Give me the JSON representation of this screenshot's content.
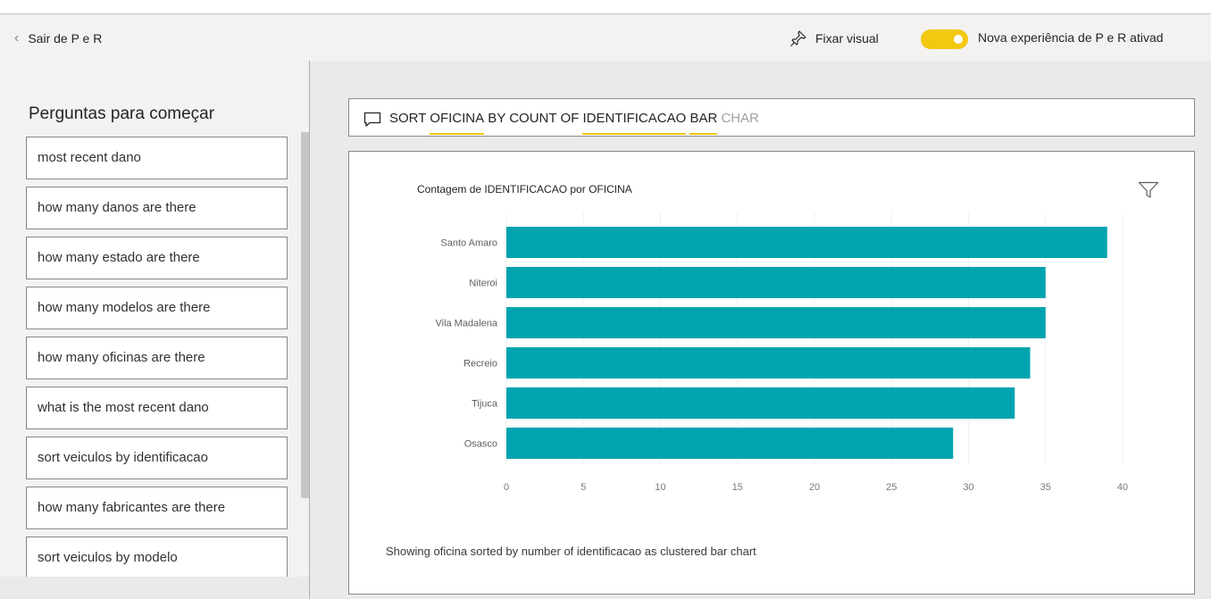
{
  "topbar": {
    "exit_label": "Sair de P e R",
    "pin_label": "Fixar visual",
    "toggle_label": "Nova experiência de P e R ativad",
    "toggle_on": true,
    "accent_color": "#f2c811"
  },
  "sidebar": {
    "heading": "Perguntas para começar",
    "suggestions": [
      "most recent dano",
      "how many danos are there",
      "how many estado are there",
      "how many modelos are there",
      "how many oficinas are there",
      "what is the most recent dano",
      "sort veiculos by identificacao",
      "how many fabricantes are there",
      "sort veiculos by modelo"
    ]
  },
  "question": {
    "tokens": [
      {
        "text": "SORT ",
        "style": "plain"
      },
      {
        "text": "OFICINA",
        "style": "underlined"
      },
      {
        "text": " BY COUNT OF ",
        "style": "plain"
      },
      {
        "text": "IDENTIFICACAO",
        "style": "underlined"
      },
      {
        "text": " ",
        "style": "plain"
      },
      {
        "text": "BAR",
        "style": "underlined"
      },
      {
        "text": " CHAR",
        "style": "ghost"
      }
    ]
  },
  "visual": {
    "caption": "Showing oficina sorted by number of identificacao as clustered bar chart"
  },
  "chart_data": {
    "type": "bar",
    "orientation": "horizontal",
    "title": "Contagem de IDENTIFICACAO por OFICINA",
    "categories": [
      "Santo Amaro",
      "Niteroi",
      "Vila Madalena",
      "Recreio",
      "Tijuca",
      "Osasco"
    ],
    "values": [
      39,
      35,
      35,
      34,
      33,
      29
    ],
    "xlim": [
      0,
      40
    ],
    "xticks": [
      0,
      5,
      10,
      15,
      20,
      25,
      30,
      35,
      40
    ],
    "grid": true,
    "bar_color": "#01a4ae",
    "xlabel": "",
    "ylabel": ""
  }
}
